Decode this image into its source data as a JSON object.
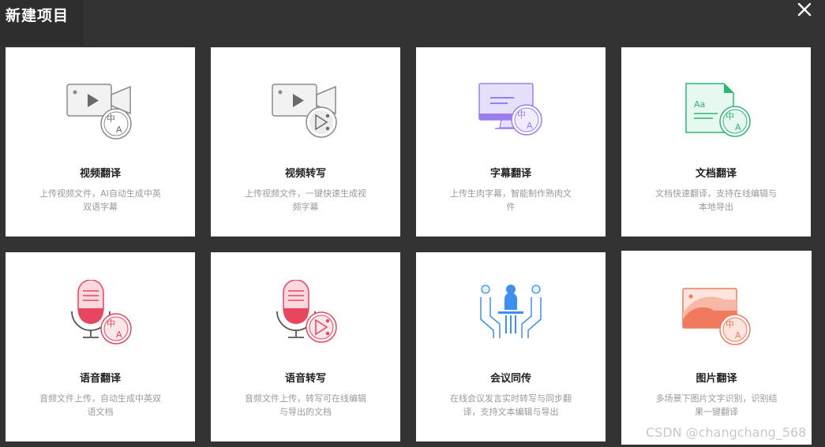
{
  "dialog": {
    "title": "新建项目",
    "close_icon": "close-icon"
  },
  "cards": [
    {
      "title": "视频翻译",
      "desc": "上传视频文件，AI自动生成中英双语字幕",
      "icon": "video-translate-icon"
    },
    {
      "title": "视频转写",
      "desc": "上传视频文件，一键快速生成视频字幕",
      "icon": "video-transcribe-icon"
    },
    {
      "title": "字幕翻译",
      "desc": "上传生肉字幕，智能制作熟肉文件",
      "icon": "subtitle-translate-icon"
    },
    {
      "title": "文档翻译",
      "desc": "文档快速翻译，支持在线编辑与本地导出",
      "icon": "document-translate-icon"
    },
    {
      "title": "语音翻译",
      "desc": "音频文件上传，自动生成中英双语文档",
      "icon": "audio-translate-icon"
    },
    {
      "title": "语音转写",
      "desc": "音频文件上传，转写可在线编辑与导出的文档",
      "icon": "audio-transcribe-icon"
    },
    {
      "title": "会议同传",
      "desc": "在线会议发言实时转写与同步翻译，支持文本编辑与导出",
      "icon": "meeting-interpret-icon"
    },
    {
      "title": "图片翻译",
      "desc": "多场景下图片文字识别，识别结果一键翻译",
      "icon": "image-translate-icon"
    }
  ],
  "watermark": "CSDN @changchang_568",
  "colors": {
    "background": "#333333",
    "card": "#ffffff",
    "video_gray": "#8a8a8a",
    "subtitle_purple": "#9b7df0",
    "document_green": "#2bb673",
    "audio_red": "#e8455f",
    "meeting_blue": "#3d8ff0",
    "image_orange": "#f07a5e"
  }
}
